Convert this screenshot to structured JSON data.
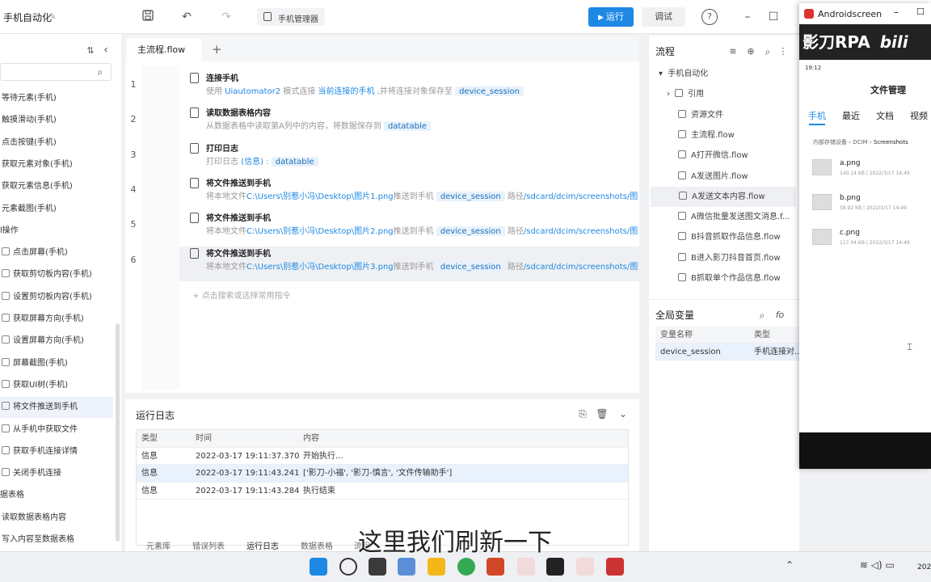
{
  "app": {
    "title": "手机自动化",
    "phone_manager": "手机管理器",
    "run_label": "运行",
    "debug_label": "调试"
  },
  "left_panel": {
    "items": [
      {
        "label": "等待元素(手机)",
        "indent": true
      },
      {
        "label": "触摸滑动(手机)",
        "indent": true
      },
      {
        "label": "点击按键(手机)",
        "indent": true
      },
      {
        "label": "获取元素对象(手机)",
        "indent": true
      },
      {
        "label": "获取元素信息(手机)",
        "indent": true
      },
      {
        "label": "元素截图(手机)",
        "indent": true
      },
      {
        "label": "l操作",
        "indent": false
      },
      {
        "label": "点击屏幕(手机)",
        "indent": true
      },
      {
        "label": "获取剪切板内容(手机)",
        "indent": true
      },
      {
        "label": "设置剪切板内容(手机)",
        "indent": true
      },
      {
        "label": "获取屏幕方向(手机)",
        "indent": true
      },
      {
        "label": "设置屏幕方向(手机)",
        "indent": true
      },
      {
        "label": "屏幕截图(手机)",
        "indent": true
      },
      {
        "label": "获取UI树(手机)",
        "indent": true
      },
      {
        "label": "将文件推送到手机",
        "indent": true,
        "selected": true
      },
      {
        "label": "从手机中获取文件",
        "indent": true
      },
      {
        "label": "获取手机连接详情",
        "indent": true
      },
      {
        "label": "关闭手机连接",
        "indent": true
      },
      {
        "label": "据表格",
        "indent": false
      },
      {
        "label": "读取数据表格内容",
        "indent": true
      },
      {
        "label": "写入内容至数据表格",
        "indent": true
      }
    ]
  },
  "editor": {
    "tab": "主流程.flow",
    "add_hint": "点击搜索或选择常用指令",
    "steps": [
      {
        "num": "1",
        "title": "连接手机",
        "desc": [
          [
            "使用 ",
            "t"
          ],
          [
            "Uiautomator2",
            "h"
          ],
          [
            " 模式连接 ",
            "t"
          ],
          [
            "当前连接的手机",
            "h"
          ],
          [
            " ,并将连接对象保存至 ",
            "t"
          ],
          [
            "device_session",
            "p"
          ]
        ]
      },
      {
        "num": "2",
        "title": "读取数据表格内容",
        "desc": [
          [
            "从数据表格中读取第A列中的内容，将数据保存到 ",
            "t"
          ],
          [
            "datatable",
            "p"
          ]
        ]
      },
      {
        "num": "3",
        "title": "打印日志",
        "desc": [
          [
            "打印日志 ",
            "t"
          ],
          [
            "(信息)",
            "h"
          ],
          [
            " : ",
            "t"
          ],
          [
            "datatable",
            "p"
          ]
        ]
      },
      {
        "num": "4",
        "title": "将文件推送到手机",
        "desc": [
          [
            "将本地文件",
            "t"
          ],
          [
            "C:\\Users\\别惹小冯\\Desktop\\图片1.png",
            "h"
          ],
          [
            "推送到手机 ",
            "t"
          ],
          [
            "device_session",
            "p"
          ],
          [
            " 路径",
            "t"
          ],
          [
            "/sdcard/dcim/screenshots/图...",
            "h"
          ]
        ]
      },
      {
        "num": "5",
        "title": "将文件推送到手机",
        "desc": [
          [
            "将本地文件",
            "t"
          ],
          [
            "C:\\Users\\别惹小冯\\Desktop\\图片2.png",
            "h"
          ],
          [
            "推送到手机 ",
            "t"
          ],
          [
            "device_session",
            "p"
          ],
          [
            " 路径",
            "t"
          ],
          [
            "/sdcard/dcim/screenshots/图...",
            "h"
          ]
        ]
      },
      {
        "num": "6",
        "title": "将文件推送到手机",
        "desc": [
          [
            "将本地文件",
            "t"
          ],
          [
            "C:\\Users\\别惹小冯\\Desktop\\图片3.png",
            "h"
          ],
          [
            "推送到手机 ",
            "t"
          ],
          [
            "device_session",
            "p"
          ],
          [
            " 路径",
            "t"
          ],
          [
            "/sdcard/dcim/screenshots/图...",
            "h"
          ]
        ],
        "selected": true
      }
    ]
  },
  "log": {
    "title": "运行日志",
    "headers": [
      "类型",
      "时间",
      "内容"
    ],
    "rows": [
      {
        "type": "信息",
        "time": "2022-03-17 19:11:37.370",
        "content": "开始执行..."
      },
      {
        "type": "信息",
        "time": "2022-03-17 19:11:43.241",
        "content": "['影刀-小福', '影刀-慎言', '文件传输助手']",
        "highlight": true
      },
      {
        "type": "信息",
        "time": "2022-03-17 19:11:43.284",
        "content": "执行结束"
      }
    ],
    "bottom_tabs": [
      "元素库",
      "错误列表",
      "运行日志",
      "数据表格",
      "流程"
    ]
  },
  "flow_panel": {
    "title": "流程",
    "items": [
      {
        "label": "手机自动化",
        "level": 0
      },
      {
        "label": "引用",
        "level": 1,
        "expandable": true
      },
      {
        "label": "资源文件",
        "level": 1
      },
      {
        "label": "主流程.flow",
        "level": 1
      },
      {
        "label": "A打开微信.flow",
        "level": 1
      },
      {
        "label": "A发送图片.flow",
        "level": 1
      },
      {
        "label": "A发送文本内容.flow",
        "level": 1,
        "selected": true
      },
      {
        "label": "A微信批量发送图文消息.f...",
        "level": 1
      },
      {
        "label": "B抖音抓取作品信息.flow",
        "level": 1
      },
      {
        "label": "B进入影刀抖音首页.flow",
        "level": 1
      },
      {
        "label": "B抓取单个作品信息.flow",
        "level": 1
      }
    ]
  },
  "globals": {
    "title": "全局变量",
    "headers": [
      "变量名称",
      "类型"
    ],
    "rows": [
      {
        "name": "device_session",
        "type": "手机连接对..."
      }
    ]
  },
  "phone": {
    "window_title": "Androidscreen",
    "banner": "影刀RPA",
    "status_time": "19:12",
    "app_title": "文件管理",
    "tabs": [
      "手机",
      "最近",
      "文档",
      "视频"
    ],
    "breadcrumb": [
      "内部存储设备",
      "DCIM",
      "Screenshots"
    ],
    "files": [
      {
        "name": "a.png",
        "meta": "140.14 KB  |  2022/3/17 14:49"
      },
      {
        "name": "b.png",
        "meta": "58.92 KB  |  2022/3/17 14:49"
      },
      {
        "name": "c.png",
        "meta": "117.04 KB  |  2022/3/17 14:49"
      }
    ]
  },
  "taskbar": {
    "clock": "202"
  },
  "subtitle": "这里我们刷新一下"
}
